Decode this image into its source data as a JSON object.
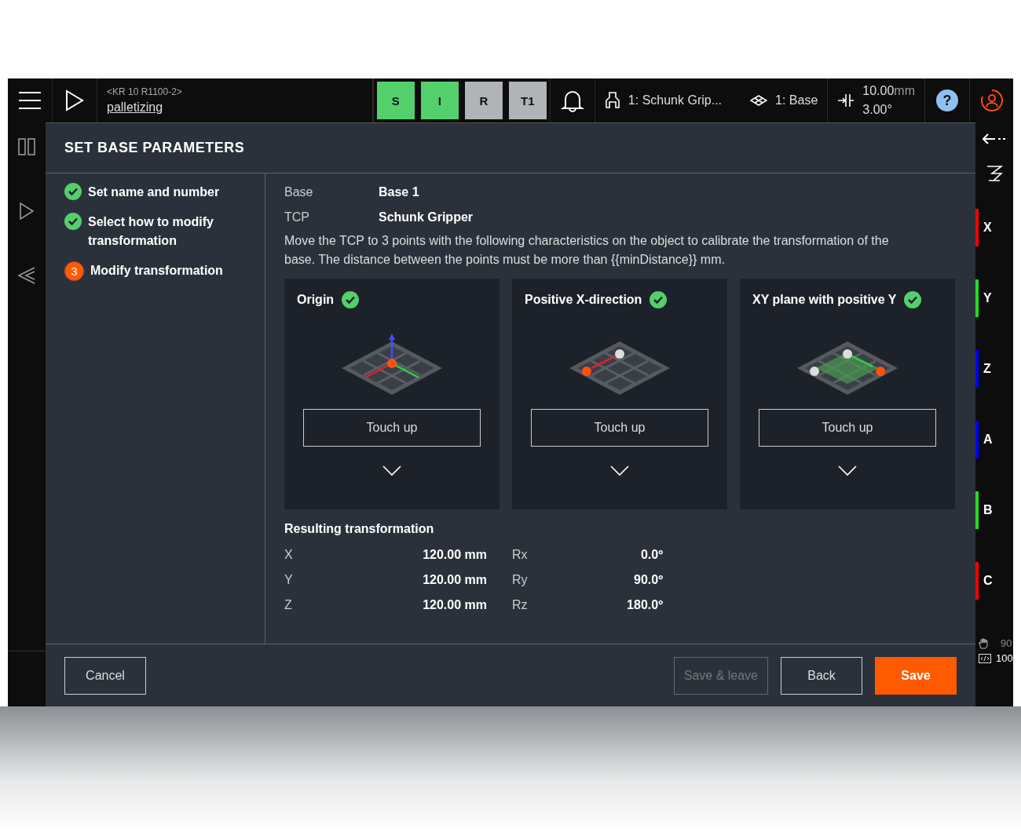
{
  "topbar": {
    "robot": "<KR 10 R1100-2>",
    "program": "palletizing",
    "modes": [
      {
        "label": "S",
        "selected": true
      },
      {
        "label": "I",
        "selected": true
      },
      {
        "label": "R",
        "selected": false
      },
      {
        "label": "T1",
        "selected": false
      }
    ],
    "tool": "1: Schunk Grip...",
    "base": "1: Base",
    "increment_distance": "10.00",
    "increment_unit": "mm",
    "increment_angle": "3.00°",
    "help": "?"
  },
  "dialog": {
    "title": "SET BASE PARAMETERS",
    "steps": [
      {
        "label": "Set name and number",
        "done": true
      },
      {
        "label": "Select how to modify transformation",
        "done": true
      },
      {
        "label": "Modify transformation",
        "done": false,
        "number": "3"
      }
    ],
    "info": [
      {
        "label": "Base",
        "value": "Base 1"
      },
      {
        "label": "TCP",
        "value": "Schunk Gripper"
      }
    ],
    "description": "Move the TCP to 3 points with the following characteristics on the object to calibrate the transformation of the base. The distance between the points must be more than {{minDistance}} mm.",
    "points": [
      {
        "title": "Origin",
        "done": true,
        "kind": "origin",
        "button": "Touch up"
      },
      {
        "title": "Positive X-direction",
        "done": true,
        "kind": "x",
        "button": "Touch up"
      },
      {
        "title": "XY plane with positive Y",
        "done": true,
        "kind": "xy",
        "button": "Touch up"
      }
    ],
    "result_title": "Resulting transformation",
    "result": [
      {
        "label": "X",
        "value": "120.00 mm",
        "rlabel": "Rx",
        "rvalue": "0.0º"
      },
      {
        "label": "Y",
        "value": "120.00 mm",
        "rlabel": "Ry",
        "rvalue": "90.0º"
      },
      {
        "label": "Z",
        "value": "120.00 mm",
        "rlabel": "Rz",
        "rvalue": "180.0º"
      }
    ],
    "buttons": [
      {
        "label": "Cancel",
        "kind": "secondary",
        "disabled": false
      },
      {
        "label": "Save & leave",
        "kind": "secondary",
        "disabled": true
      },
      {
        "label": "Back",
        "kind": "secondary",
        "disabled": false
      },
      {
        "label": "Save",
        "kind": "primary",
        "disabled": false
      }
    ]
  },
  "axes": [
    {
      "label": "X",
      "color": "#ff0000"
    },
    {
      "label": "Y",
      "color": "#22dd22"
    },
    {
      "label": "Z",
      "color": "#0000ff"
    },
    {
      "label": "A",
      "color": "#0000ff"
    },
    {
      "label": "B",
      "color": "#22dd22"
    },
    {
      "label": "C",
      "color": "#ff0000"
    }
  ],
  "override": {
    "hand": "90",
    "program": "100"
  }
}
